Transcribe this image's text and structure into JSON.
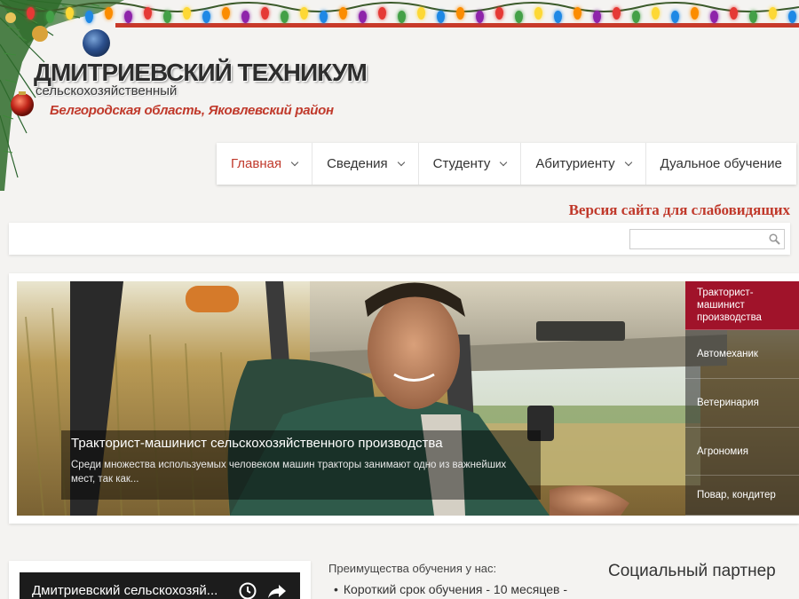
{
  "header": {
    "title": "ДМИТРИЕВСКИЙ ТЕХНИКУМ",
    "subtitle": "сельскохозяйственный",
    "region": "Белгородская область, Яковлевский район"
  },
  "nav": {
    "items": [
      {
        "label": "Главная",
        "dropdown": true,
        "active": true
      },
      {
        "label": "Сведения",
        "dropdown": true
      },
      {
        "label": "Студенту",
        "dropdown": true
      },
      {
        "label": "Абитуриенту",
        "dropdown": true
      },
      {
        "label": "Дуальное обучение",
        "dropdown": false
      }
    ]
  },
  "accessibility": {
    "label": "Версия сайта для слабовидящих"
  },
  "search": {
    "placeholder": "",
    "icon": "search-icon"
  },
  "slider": {
    "caption_title": "Тракторист-машинист сельскохозяйственного производства",
    "caption_text": "Среди множества используемых человеком машин тракторы занимают одно из важнейших мест, так как...",
    "tabs": [
      {
        "label": "Тракторист-машинист производства",
        "active": true
      },
      {
        "label": "Автомеханик"
      },
      {
        "label": "Ветеринария"
      },
      {
        "label": "Агрономия"
      },
      {
        "label": "Повар, кондитер"
      }
    ]
  },
  "video": {
    "title": "Дмитриевский сельскохозяй..."
  },
  "advantages": {
    "heading": "Преимущества обучения у нас:",
    "items": [
      "Короткий срок обучения - 10 месяцев -"
    ]
  },
  "partner": {
    "heading": "Социальный партнер"
  },
  "colors": {
    "accent": "#c0392b",
    "active_tab": "#a0132a",
    "background": "#f4f3f1"
  }
}
